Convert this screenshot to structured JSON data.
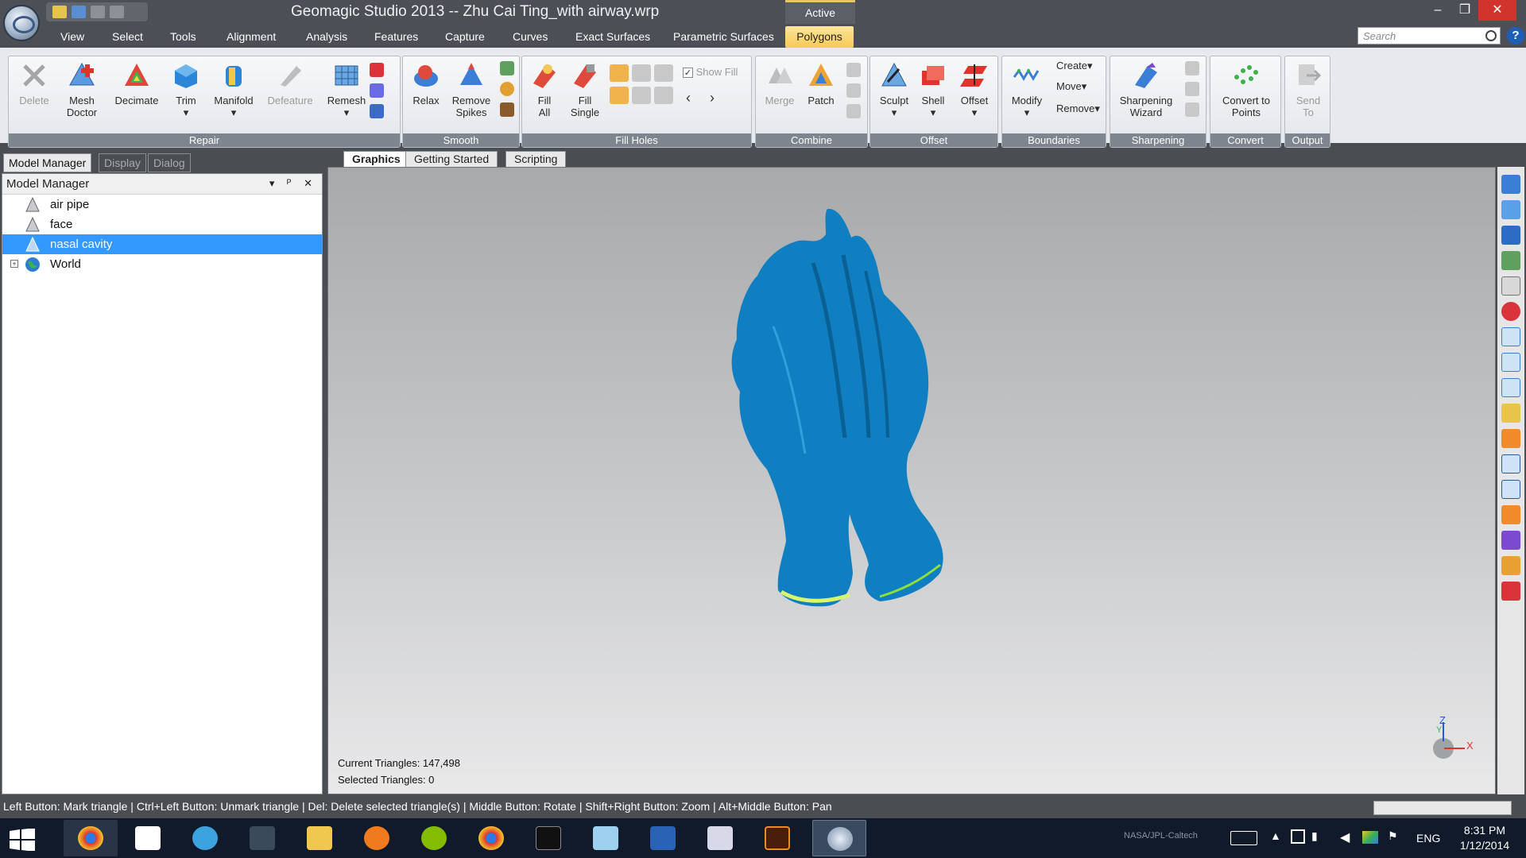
{
  "window": {
    "title": "Geomagic Studio 2013 -- Zhu Cai Ting_with airway.wrp",
    "context_tab": "Active",
    "minimize": "–",
    "restore": "❐",
    "close": "✕"
  },
  "menu": {
    "items": [
      "View",
      "Select",
      "Tools",
      "Alignment",
      "Analysis",
      "Features",
      "Capture",
      "Curves",
      "Exact Surfaces",
      "Parametric Surfaces"
    ],
    "active": "Polygons",
    "search_placeholder": "Search",
    "help": "?"
  },
  "ribbon": {
    "groups": {
      "repair": "Repair",
      "smooth": "Smooth",
      "fill_holes": "Fill Holes",
      "combine": "Combine",
      "offset": "Offset",
      "boundaries": "Boundaries",
      "sharpening": "Sharpening",
      "convert": "Convert",
      "output": "Output"
    },
    "buttons": {
      "delete": "Delete",
      "mesh_doctor_1": "Mesh",
      "mesh_doctor_2": "Doctor",
      "decimate": "Decimate",
      "trim": "Trim",
      "manifold": "Manifold",
      "defeature": "Defeature",
      "remesh": "Remesh",
      "relax": "Relax",
      "remove_spikes_1": "Remove",
      "remove_spikes_2": "Spikes",
      "fill_all_1": "Fill",
      "fill_all_2": "All",
      "fill_single_1": "Fill",
      "fill_single_2": "Single",
      "show_fill": "Show Fill",
      "merge": "Merge",
      "patch": "Patch",
      "sculpt": "Sculpt",
      "shell": "Shell",
      "offset": "Offset",
      "modify": "Modify",
      "create": "Create",
      "move": "Move",
      "remove": "Remove",
      "sharpening_1": "Sharpening",
      "sharpening_2": "Wizard",
      "convert_1": "Convert to",
      "convert_2": "Points",
      "send_1": "Send",
      "send_2": "To"
    },
    "arrow": "▾"
  },
  "panel_tabs": [
    "Model Manager",
    "Display",
    "Dialog"
  ],
  "model_manager": {
    "title": "Model Manager",
    "tools": "▾ ᴾ ✕",
    "items": [
      {
        "label": "air pipe",
        "selected": false
      },
      {
        "label": "face",
        "selected": false
      },
      {
        "label": "nasal cavity",
        "selected": true
      },
      {
        "label": "World",
        "selected": false,
        "expander": "+"
      }
    ]
  },
  "viewport_tabs": [
    "Graphics",
    "Getting Started",
    "Scripting"
  ],
  "viewport": {
    "current_triangles": "Current Triangles: 147,498",
    "selected_triangles": "Selected Triangles: 0",
    "axis_z": "Z",
    "axis_y": "Y",
    "axis_x": "X",
    "model_color": "#0f7fc2"
  },
  "status": {
    "text": "Left Button: Mark triangle | Ctrl+Left Button: Unmark triangle | Del: Delete selected triangle(s) | Middle Button: Rotate | Shift+Right Button: Zoom | Alt+Middle Button: Pan"
  },
  "taskbar": {
    "watermark": "NASA/JPL-Caltech",
    "language": "ENG",
    "time": "8:31 PM",
    "date": "1/12/2014"
  }
}
